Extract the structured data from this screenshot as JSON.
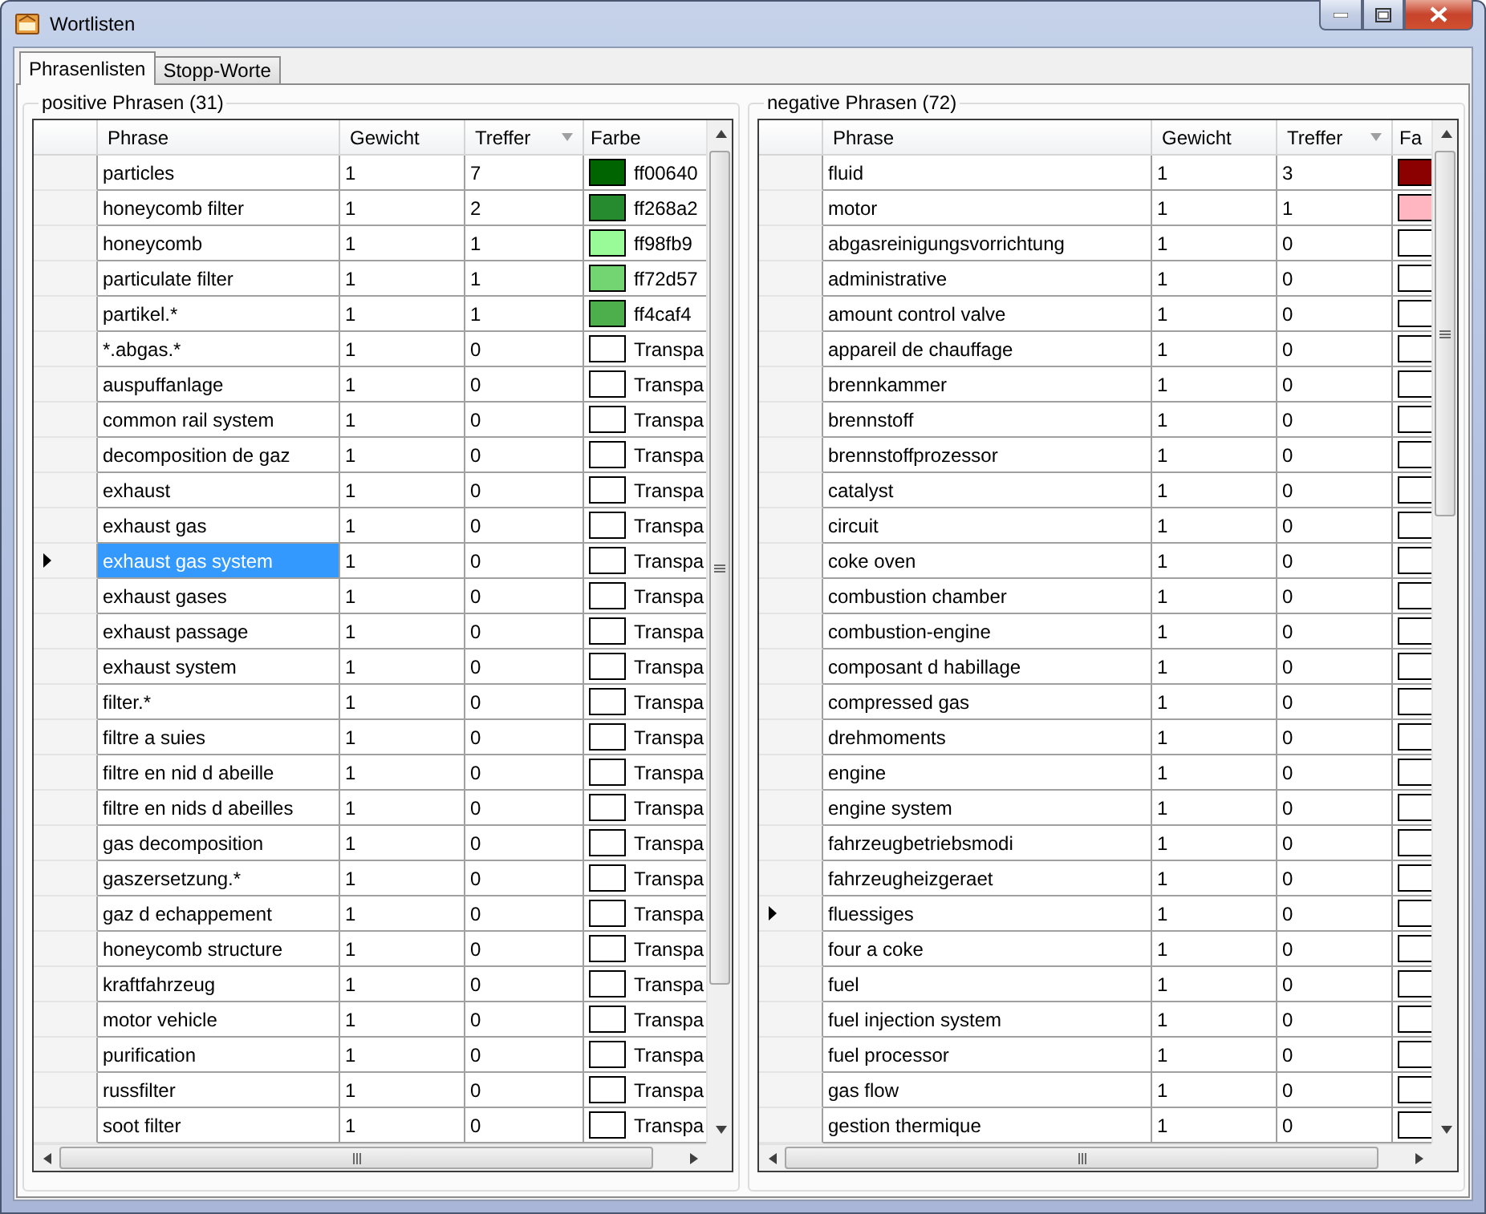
{
  "window": {
    "title": "Wortlisten"
  },
  "tabs": [
    {
      "label": "Phrasenlisten",
      "selected": true
    },
    {
      "label": "Stopp-Worte",
      "selected": false
    }
  ],
  "panels": [
    {
      "title": "positive Phrasen (31)",
      "columns": [
        {
          "label": "Phrase",
          "sorted": false
        },
        {
          "label": "Gewicht",
          "sorted": false
        },
        {
          "label": "Treffer",
          "sorted": true
        },
        {
          "label": "Farbe",
          "sorted": false
        }
      ],
      "rows": [
        {
          "phrase": "particles",
          "gewicht": "1",
          "treffer": "7",
          "color": "#006400",
          "farbe": "ff00640",
          "selected": false,
          "current": false
        },
        {
          "phrase": "honeycomb filter",
          "gewicht": "1",
          "treffer": "2",
          "color": "#268a2f",
          "farbe": "ff268a2",
          "selected": false,
          "current": false
        },
        {
          "phrase": "honeycomb",
          "gewicht": "1",
          "treffer": "1",
          "color": "#98fb98",
          "farbe": "ff98fb9",
          "selected": false,
          "current": false
        },
        {
          "phrase": "particulate filter",
          "gewicht": "1",
          "treffer": "1",
          "color": "#72d572",
          "farbe": "ff72d57",
          "selected": false,
          "current": false
        },
        {
          "phrase": "partikel.*",
          "gewicht": "1",
          "treffer": "1",
          "color": "#4caf4c",
          "farbe": "ff4caf4",
          "selected": false,
          "current": false
        },
        {
          "phrase": "*.abgas.*",
          "gewicht": "1",
          "treffer": "0",
          "color": "#ffffff",
          "farbe": "Transpa",
          "selected": false,
          "current": false
        },
        {
          "phrase": "auspuffanlage",
          "gewicht": "1",
          "treffer": "0",
          "color": "#ffffff",
          "farbe": "Transpa",
          "selected": false,
          "current": false
        },
        {
          "phrase": "common rail system",
          "gewicht": "1",
          "treffer": "0",
          "color": "#ffffff",
          "farbe": "Transpa",
          "selected": false,
          "current": false
        },
        {
          "phrase": "decomposition de gaz",
          "gewicht": "1",
          "treffer": "0",
          "color": "#ffffff",
          "farbe": "Transpa",
          "selected": false,
          "current": false
        },
        {
          "phrase": "exhaust",
          "gewicht": "1",
          "treffer": "0",
          "color": "#ffffff",
          "farbe": "Transpa",
          "selected": false,
          "current": false
        },
        {
          "phrase": "exhaust gas",
          "gewicht": "1",
          "treffer": "0",
          "color": "#ffffff",
          "farbe": "Transpa",
          "selected": false,
          "current": false
        },
        {
          "phrase": "exhaust gas system",
          "gewicht": "1",
          "treffer": "0",
          "color": "#ffffff",
          "farbe": "Transpa",
          "selected": true,
          "current": true
        },
        {
          "phrase": "exhaust gases",
          "gewicht": "1",
          "treffer": "0",
          "color": "#ffffff",
          "farbe": "Transpa",
          "selected": false,
          "current": false
        },
        {
          "phrase": "exhaust passage",
          "gewicht": "1",
          "treffer": "0",
          "color": "#ffffff",
          "farbe": "Transpa",
          "selected": false,
          "current": false
        },
        {
          "phrase": "exhaust system",
          "gewicht": "1",
          "treffer": "0",
          "color": "#ffffff",
          "farbe": "Transpa",
          "selected": false,
          "current": false
        },
        {
          "phrase": "filter.*",
          "gewicht": "1",
          "treffer": "0",
          "color": "#ffffff",
          "farbe": "Transpa",
          "selected": false,
          "current": false
        },
        {
          "phrase": "filtre a suies",
          "gewicht": "1",
          "treffer": "0",
          "color": "#ffffff",
          "farbe": "Transpa",
          "selected": false,
          "current": false
        },
        {
          "phrase": "filtre en nid d abeille",
          "gewicht": "1",
          "treffer": "0",
          "color": "#ffffff",
          "farbe": "Transpa",
          "selected": false,
          "current": false
        },
        {
          "phrase": "filtre en nids d abeilles",
          "gewicht": "1",
          "treffer": "0",
          "color": "#ffffff",
          "farbe": "Transpa",
          "selected": false,
          "current": false
        },
        {
          "phrase": "gas decomposition",
          "gewicht": "1",
          "treffer": "0",
          "color": "#ffffff",
          "farbe": "Transpa",
          "selected": false,
          "current": false
        },
        {
          "phrase": "gaszersetzung.*",
          "gewicht": "1",
          "treffer": "0",
          "color": "#ffffff",
          "farbe": "Transpa",
          "selected": false,
          "current": false
        },
        {
          "phrase": "gaz d echappement",
          "gewicht": "1",
          "treffer": "0",
          "color": "#ffffff",
          "farbe": "Transpa",
          "selected": false,
          "current": false
        },
        {
          "phrase": "honeycomb structure",
          "gewicht": "1",
          "treffer": "0",
          "color": "#ffffff",
          "farbe": "Transpa",
          "selected": false,
          "current": false
        },
        {
          "phrase": "kraftfahrzeug",
          "gewicht": "1",
          "treffer": "0",
          "color": "#ffffff",
          "farbe": "Transpa",
          "selected": false,
          "current": false
        },
        {
          "phrase": "motor vehicle",
          "gewicht": "1",
          "treffer": "0",
          "color": "#ffffff",
          "farbe": "Transpa",
          "selected": false,
          "current": false
        },
        {
          "phrase": "purification",
          "gewicht": "1",
          "treffer": "0",
          "color": "#ffffff",
          "farbe": "Transpa",
          "selected": false,
          "current": false
        },
        {
          "phrase": "russfilter",
          "gewicht": "1",
          "treffer": "0",
          "color": "#ffffff",
          "farbe": "Transpa",
          "selected": false,
          "current": false
        },
        {
          "phrase": "soot filter",
          "gewicht": "1",
          "treffer": "0",
          "color": "#ffffff",
          "farbe": "Transpa",
          "selected": false,
          "current": false
        }
      ]
    },
    {
      "title": "negative Phrasen (72)",
      "columns": [
        {
          "label": "Phrase",
          "sorted": false
        },
        {
          "label": "Gewicht",
          "sorted": false
        },
        {
          "label": "Treffer",
          "sorted": true
        },
        {
          "label": "Fa",
          "sorted": false
        }
      ],
      "rows": [
        {
          "phrase": "fluid",
          "gewicht": "1",
          "treffer": "3",
          "color": "#8b0000",
          "selected": false,
          "current": false
        },
        {
          "phrase": "motor",
          "gewicht": "1",
          "treffer": "1",
          "color": "#ffb6c1",
          "selected": false,
          "current": false
        },
        {
          "phrase": "abgasreinigungsvorrichtung",
          "gewicht": "1",
          "treffer": "0",
          "color": "#ffffff",
          "selected": false,
          "current": false
        },
        {
          "phrase": "administrative",
          "gewicht": "1",
          "treffer": "0",
          "color": "#ffffff",
          "selected": false,
          "current": false
        },
        {
          "phrase": "amount control valve",
          "gewicht": "1",
          "treffer": "0",
          "color": "#ffffff",
          "selected": false,
          "current": false
        },
        {
          "phrase": "appareil de chauffage",
          "gewicht": "1",
          "treffer": "0",
          "color": "#ffffff",
          "selected": false,
          "current": false
        },
        {
          "phrase": "brennkammer",
          "gewicht": "1",
          "treffer": "0",
          "color": "#ffffff",
          "selected": false,
          "current": false
        },
        {
          "phrase": "brennstoff",
          "gewicht": "1",
          "treffer": "0",
          "color": "#ffffff",
          "selected": false,
          "current": false
        },
        {
          "phrase": "brennstoffprozessor",
          "gewicht": "1",
          "treffer": "0",
          "color": "#ffffff",
          "selected": false,
          "current": false
        },
        {
          "phrase": "catalyst",
          "gewicht": "1",
          "treffer": "0",
          "color": "#ffffff",
          "selected": false,
          "current": false
        },
        {
          "phrase": "circuit",
          "gewicht": "1",
          "treffer": "0",
          "color": "#ffffff",
          "selected": false,
          "current": false
        },
        {
          "phrase": "coke oven",
          "gewicht": "1",
          "treffer": "0",
          "color": "#ffffff",
          "selected": false,
          "current": false
        },
        {
          "phrase": "combustion chamber",
          "gewicht": "1",
          "treffer": "0",
          "color": "#ffffff",
          "selected": false,
          "current": false
        },
        {
          "phrase": "combustion-engine",
          "gewicht": "1",
          "treffer": "0",
          "color": "#ffffff",
          "selected": false,
          "current": false
        },
        {
          "phrase": "composant d habillage",
          "gewicht": "1",
          "treffer": "0",
          "color": "#ffffff",
          "selected": false,
          "current": false
        },
        {
          "phrase": "compressed gas",
          "gewicht": "1",
          "treffer": "0",
          "color": "#ffffff",
          "selected": false,
          "current": false
        },
        {
          "phrase": "drehmoments",
          "gewicht": "1",
          "treffer": "0",
          "color": "#ffffff",
          "selected": false,
          "current": false
        },
        {
          "phrase": "engine",
          "gewicht": "1",
          "treffer": "0",
          "color": "#ffffff",
          "selected": false,
          "current": false
        },
        {
          "phrase": "engine system",
          "gewicht": "1",
          "treffer": "0",
          "color": "#ffffff",
          "selected": false,
          "current": false
        },
        {
          "phrase": "fahrzeugbetriebsmodi",
          "gewicht": "1",
          "treffer": "0",
          "color": "#ffffff",
          "selected": false,
          "current": false
        },
        {
          "phrase": "fahrzeugheizgeraet",
          "gewicht": "1",
          "treffer": "0",
          "color": "#ffffff",
          "selected": false,
          "current": false
        },
        {
          "phrase": "fluessiges",
          "gewicht": "1",
          "treffer": "0",
          "color": "#ffffff",
          "selected": false,
          "current": true
        },
        {
          "phrase": "four a coke",
          "gewicht": "1",
          "treffer": "0",
          "color": "#ffffff",
          "selected": false,
          "current": false
        },
        {
          "phrase": "fuel",
          "gewicht": "1",
          "treffer": "0",
          "color": "#ffffff",
          "selected": false,
          "current": false
        },
        {
          "phrase": "fuel injection system",
          "gewicht": "1",
          "treffer": "0",
          "color": "#ffffff",
          "selected": false,
          "current": false
        },
        {
          "phrase": "fuel processor",
          "gewicht": "1",
          "treffer": "0",
          "color": "#ffffff",
          "selected": false,
          "current": false
        },
        {
          "phrase": "gas flow",
          "gewicht": "1",
          "treffer": "0",
          "color": "#ffffff",
          "selected": false,
          "current": false
        },
        {
          "phrase": "gestion thermique",
          "gewicht": "1",
          "treffer": "0",
          "color": "#ffffff",
          "selected": false,
          "current": false
        }
      ]
    }
  ]
}
